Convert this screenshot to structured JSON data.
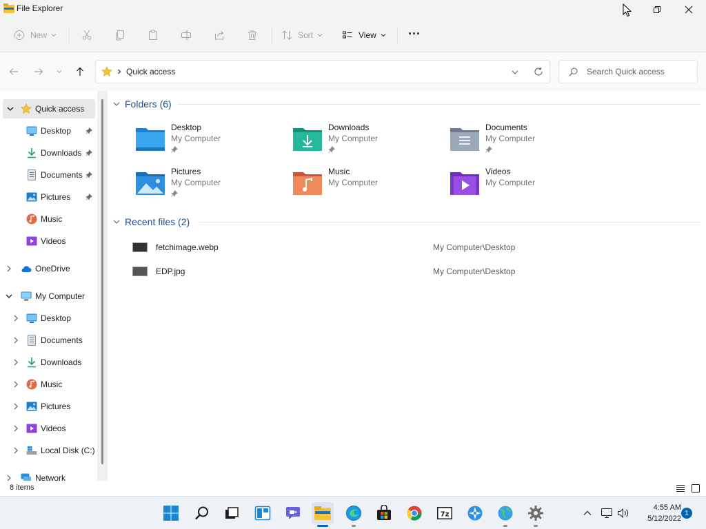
{
  "window": {
    "title": "File Explorer"
  },
  "commandbar": {
    "new_label": "New",
    "sort_label": "Sort",
    "view_label": "View",
    "more_label": "···"
  },
  "address": {
    "path": "Quick access",
    "search_placeholder": "Search Quick access"
  },
  "nav": {
    "quick_access": "Quick access",
    "qa_items": [
      "Desktop",
      "Downloads",
      "Documents",
      "Pictures",
      "Music",
      "Videos"
    ],
    "onedrive": "OneDrive",
    "my_computer": "My Computer",
    "mc_items": [
      "Desktop",
      "Documents",
      "Downloads",
      "Music",
      "Pictures",
      "Videos",
      "Local Disk (C:)"
    ],
    "network": "Network"
  },
  "folders": {
    "header": "Folders (6)",
    "items": [
      {
        "name": "Desktop",
        "location": "My Computer",
        "icon": "desktop-folder-icon",
        "pinned": true
      },
      {
        "name": "Downloads",
        "location": "My Computer",
        "icon": "downloads-folder-icon",
        "pinned": true
      },
      {
        "name": "Documents",
        "location": "My Computer",
        "icon": "documents-folder-icon",
        "pinned": true
      },
      {
        "name": "Pictures",
        "location": "My Computer",
        "icon": "pictures-folder-icon",
        "pinned": true
      },
      {
        "name": "Music",
        "location": "My Computer",
        "icon": "music-folder-icon",
        "pinned": false
      },
      {
        "name": "Videos",
        "location": "My Computer",
        "icon": "videos-folder-icon",
        "pinned": false
      }
    ]
  },
  "recent": {
    "header": "Recent files (2)",
    "items": [
      {
        "name": "fetchimage.webp",
        "location": "My Computer\\Desktop"
      },
      {
        "name": "EDP.jpg",
        "location": "My Computer\\Desktop"
      }
    ]
  },
  "status": {
    "count": "8 items"
  },
  "taskbar": {
    "time": "4:55 AM",
    "date": "5/12/2022",
    "notifications": "1"
  },
  "colors": {
    "accent": "#0063b1",
    "folder_header": "#1e4f8a"
  }
}
